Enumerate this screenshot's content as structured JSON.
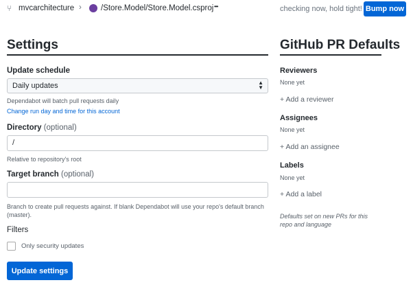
{
  "header": {
    "repo": "mvcarchitecture",
    "path": "/Store.Model/Store.Model.csproj",
    "more": "•••",
    "status": "checking now, hold tight!",
    "bump_label": "Bump now"
  },
  "settings": {
    "title": "Settings",
    "update_schedule": {
      "label": "Update schedule",
      "selected": "Daily updates",
      "help": "Dependabot will batch pull requests daily",
      "link": "Change run day and time for this account"
    },
    "directory": {
      "label": "Directory",
      "optional": "(optional)",
      "value": "/",
      "help": "Relative to repository's root"
    },
    "target_branch": {
      "label": "Target branch",
      "optional": "(optional)",
      "value": "",
      "help": "Branch to create pull requests against. If blank Dependabot will use your repo's default branch (master)."
    },
    "filters": {
      "label": "Filters",
      "security_only": "Only security updates",
      "checked": false
    },
    "submit_label": "Update settings"
  },
  "pr_defaults": {
    "title": "GitHub PR Defaults",
    "reviewers": {
      "label": "Reviewers",
      "value": "None yet",
      "add": "+ Add a reviewer"
    },
    "assignees": {
      "label": "Assignees",
      "value": "None yet",
      "add": "+ Add an assignee"
    },
    "labels": {
      "label": "Labels",
      "value": "None yet",
      "add": "+ Add a label"
    },
    "note": "Defaults set on new PRs for this repo and language"
  },
  "colors": {
    "accent": "#0366d6"
  }
}
